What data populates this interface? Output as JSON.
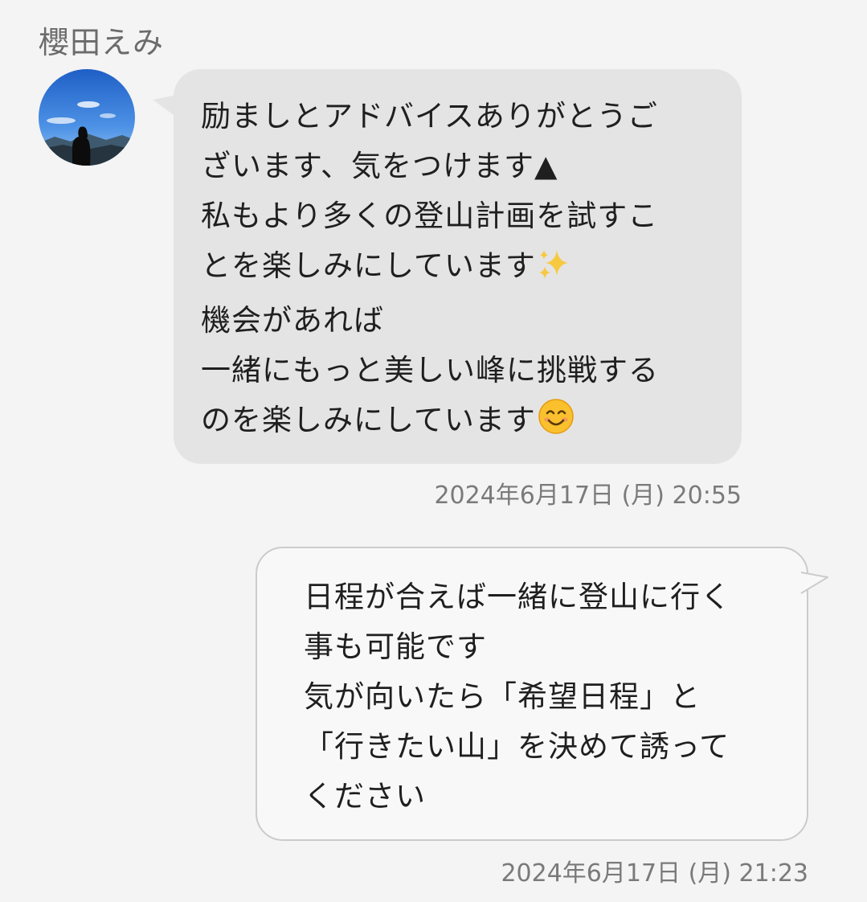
{
  "contact": {
    "name": "櫻田えみ"
  },
  "messages": [
    {
      "direction": "incoming",
      "lines": [
        "励ましとアドバイスありがとうご",
        "ざいます、気をつけます▲",
        "私もより多くの登山計画を試すこ",
        "とを楽しみにしています",
        "機会があれば",
        "一緒にもっと美しい峰に挑戦する",
        "のを楽しみにしています"
      ],
      "emojis": [
        "sparkles",
        "smiling-face"
      ],
      "timestamp": "2024年6月17日 (月) 20:55"
    },
    {
      "direction": "outgoing",
      "lines": [
        "日程が合えば一緒に登山に行く",
        "事も可能です",
        "気が向いたら「希望日程」と",
        "「行きたい山」を決めて誘って",
        "ください"
      ],
      "timestamp": "2024年6月17日 (月) 21:23"
    }
  ],
  "colors": {
    "background": "#f4f4f4",
    "incoming_bubble": "#e4e4e4",
    "outgoing_bubble": "#f8f8f8",
    "outgoing_border": "#cbcbcb"
  }
}
